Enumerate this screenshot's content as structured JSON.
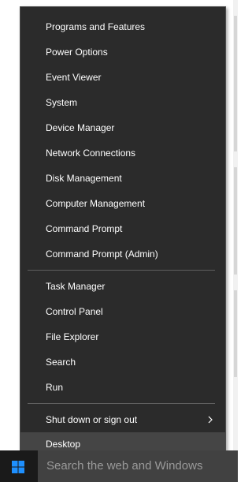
{
  "menu": {
    "group1": [
      {
        "label": "Programs and Features"
      },
      {
        "label": "Power Options"
      },
      {
        "label": "Event Viewer"
      },
      {
        "label": "System"
      },
      {
        "label": "Device Manager"
      },
      {
        "label": "Network Connections"
      },
      {
        "label": "Disk Management"
      },
      {
        "label": "Computer Management"
      },
      {
        "label": "Command Prompt"
      },
      {
        "label": "Command Prompt (Admin)"
      }
    ],
    "group2": [
      {
        "label": "Task Manager"
      },
      {
        "label": "Control Panel"
      },
      {
        "label": "File Explorer"
      },
      {
        "label": "Search"
      },
      {
        "label": "Run"
      }
    ],
    "group3": [
      {
        "label": "Shut down or sign out",
        "has_submenu": true,
        "submenu_icon": "chevron-right-icon"
      },
      {
        "label": "Desktop",
        "selected": true
      }
    ]
  },
  "taskbar": {
    "start_icon": "windows-logo-icon",
    "search_placeholder": "Search the web and Windows"
  },
  "colors": {
    "menu_bg": "#2b2b2b",
    "menu_text": "#ffffff",
    "selected_bg": "#454545",
    "taskbar_bg": "#0f0f0f",
    "search_bg": "#414141",
    "accent_blue": "#1e90ff"
  }
}
